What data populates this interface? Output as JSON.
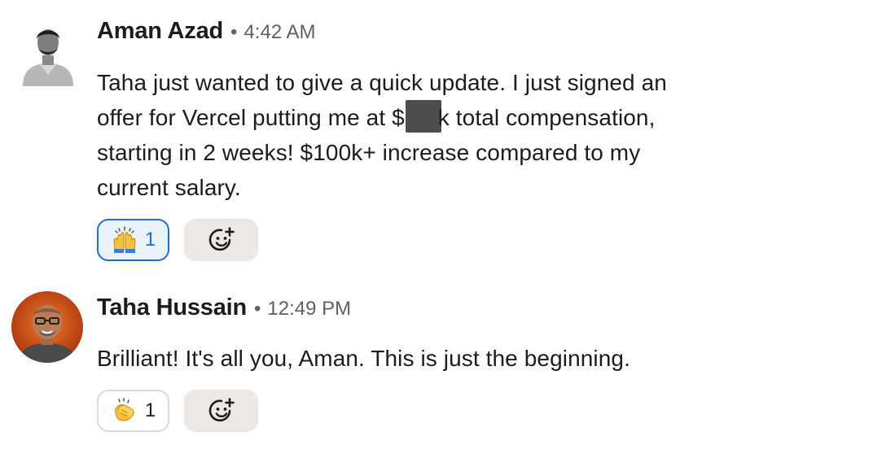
{
  "messages": [
    {
      "author": "Aman Azad",
      "separator": "•",
      "time": "4:42 AM",
      "lines": {
        "l1": "Taha just wanted to give a quick update. I just signed an",
        "l2a": "offer for Vercel putting me at $",
        "l2b": "k total compensation,",
        "l3": "starting in 2 weeks! $100k+ increase compared to my",
        "l4": "current salary."
      },
      "reaction": {
        "emoji_name": "raised-hands",
        "count": "1",
        "active": true
      }
    },
    {
      "author": "Taha Hussain",
      "separator": "•",
      "time": "12:49 PM",
      "lines": {
        "l1": "Brilliant! It's all you, Aman. This is just the beginning."
      },
      "reaction": {
        "emoji_name": "clapping-hands",
        "count": "1",
        "active": false
      }
    }
  ],
  "colors": {
    "text": "#1d1c1d",
    "muted": "#616061",
    "accent": "#1d6fc9",
    "add_reaction_bg": "#ebe8e5"
  }
}
